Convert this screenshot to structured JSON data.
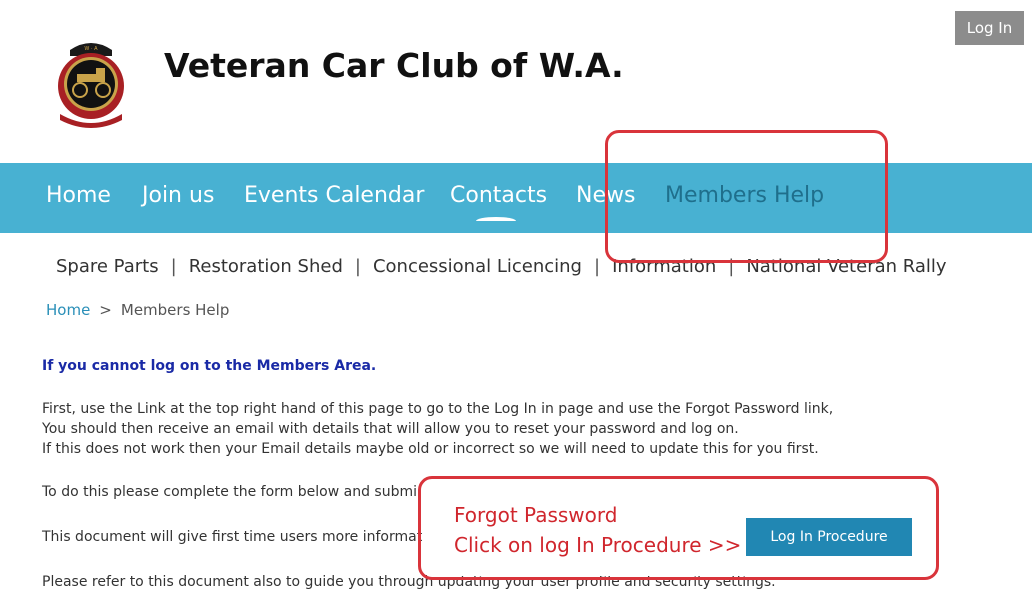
{
  "header": {
    "login_label": "Log In",
    "site_title": "Veteran Car Club of W.A."
  },
  "nav": {
    "items": [
      "Home",
      "Join us",
      "Events Calendar",
      "Contacts",
      "News",
      "Members Help"
    ]
  },
  "subnav": {
    "items": [
      "Spare Parts",
      "Restoration Shed",
      "Concessional Licencing",
      "Information",
      "National Veteran Rally"
    ],
    "separator": "|"
  },
  "breadcrumb": {
    "home": "Home",
    "separator": ">",
    "current": "Members Help"
  },
  "content": {
    "heading": "If you cannot log on to the Members Area.",
    "lines": [
      "First, use the Link at the top right hand of this page to go to the Log In in page and use the Forgot Password link,",
      "You should then receive an email with details that will allow you to reset your password and log on.",
      "If this does not work then your Email details maybe old or incorrect so we will need to update this for you first."
    ],
    "form_line": "To do this please complete the form below and submi",
    "doc_line": "This document will give first time users more informat",
    "profile_line": "Please refer to this document also to guide you through updating your user profile and security settings."
  },
  "annotation": {
    "line1": "Forgot Password",
    "line2": "Click on log In Procedure >>",
    "button_label": "Log In Procedure",
    "color": "#d9343b"
  },
  "colors": {
    "nav_bg": "#48b1d2",
    "button_blue": "#2187b3",
    "heading_blue": "#1a2aa6"
  }
}
